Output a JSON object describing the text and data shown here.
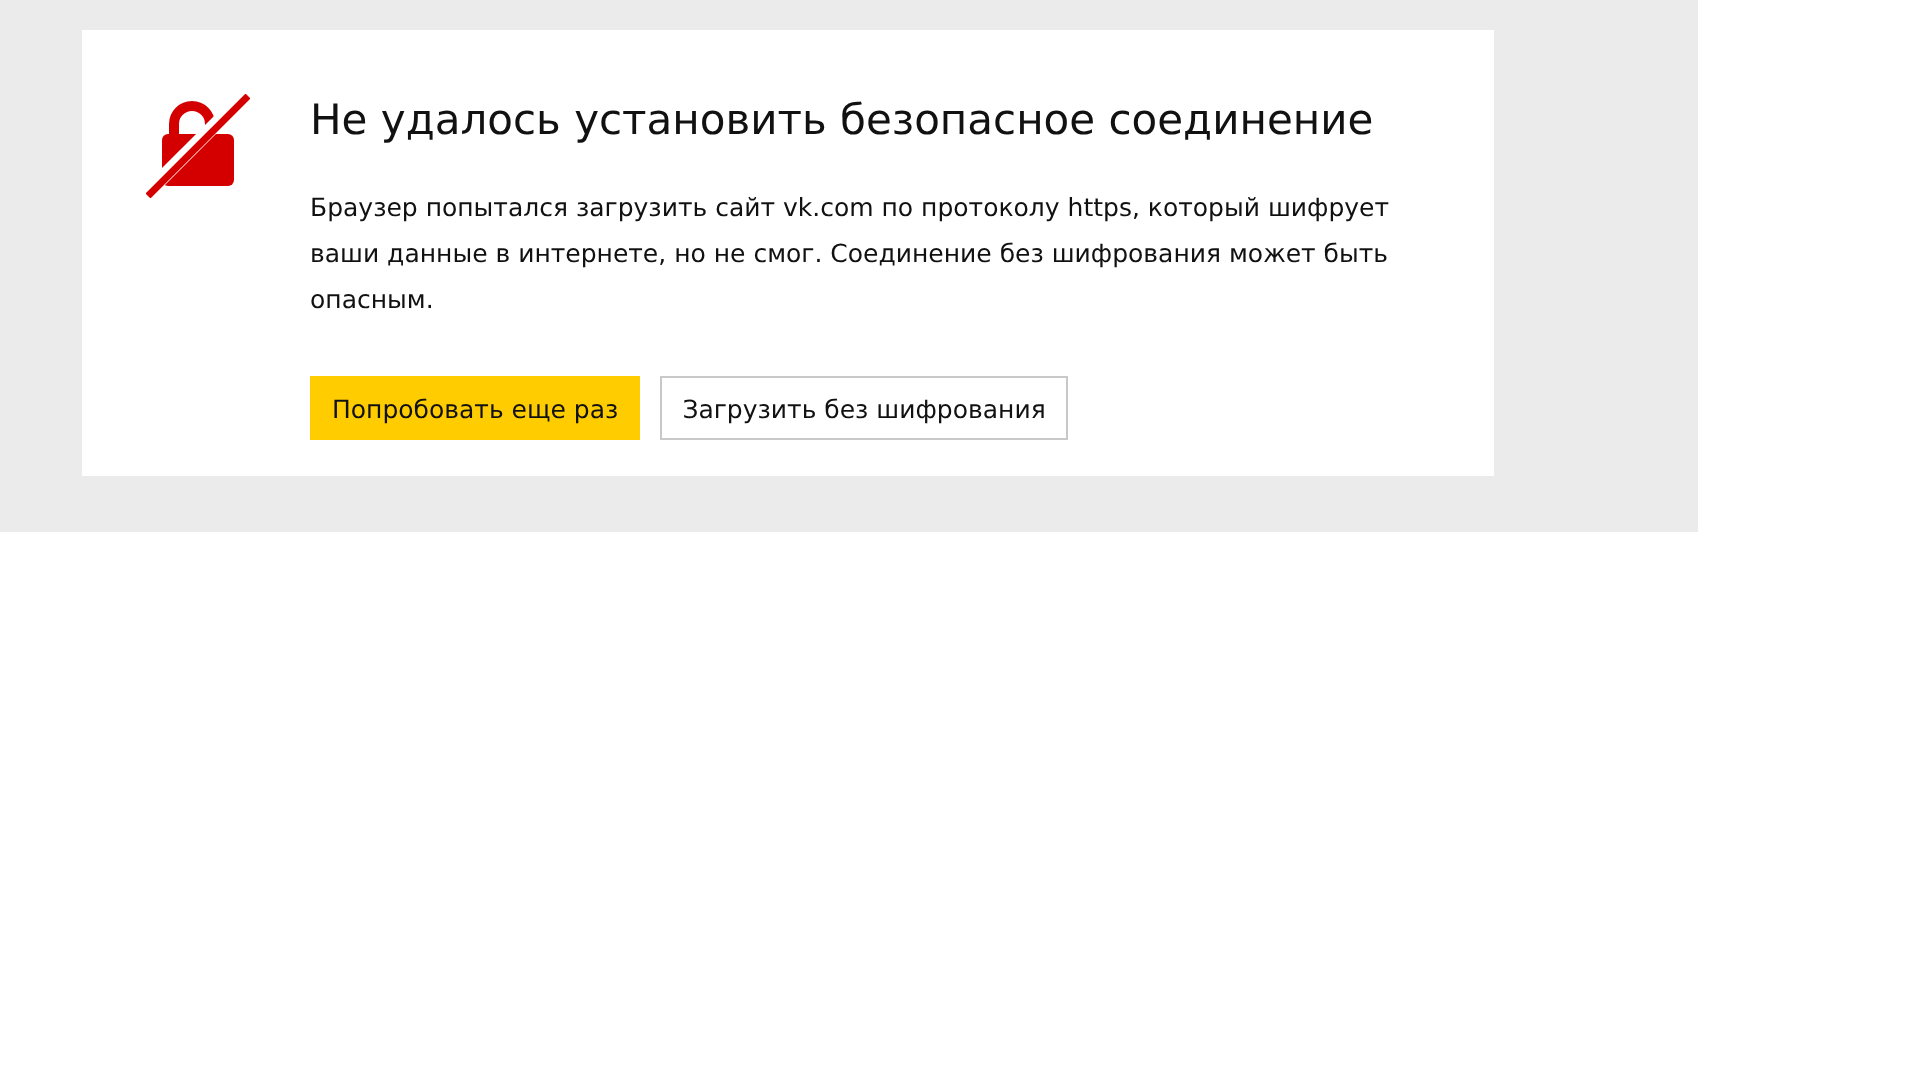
{
  "error": {
    "title": "Не удалось установить безопасное соединение",
    "message": "Браузер попытался загрузить сайт vk.com по протоколу https, который шифрует ваши данные в интернете, но не смог. Соединение без шифрования может быть опасным."
  },
  "buttons": [
    {
      "label": "Попробовать еще раз",
      "kind": "primary"
    },
    {
      "label": "Загрузить без шифрования",
      "kind": "secondary"
    }
  ]
}
